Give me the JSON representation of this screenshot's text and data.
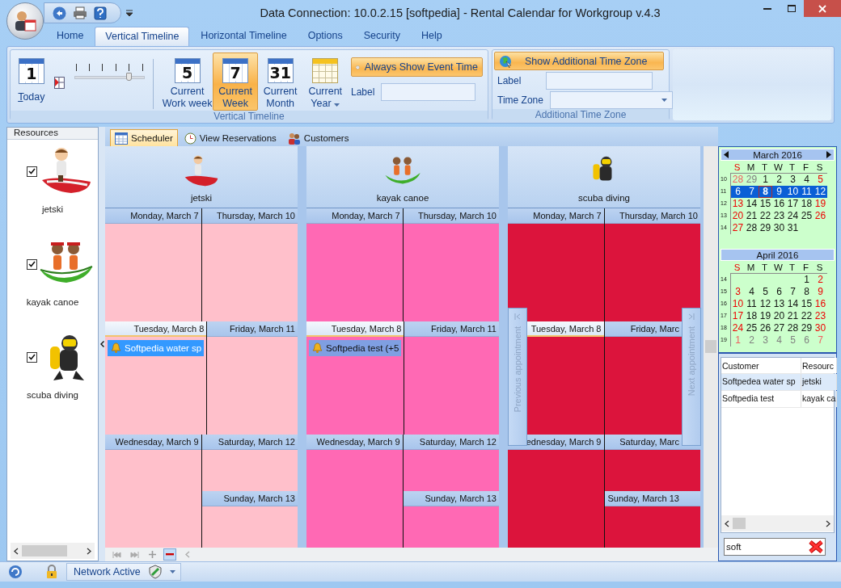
{
  "window": {
    "title": "Data Connection: 10.0.2.15 [softpedia] - Rental Calendar for Workgroup v.4.3"
  },
  "ribbon_tabs": [
    {
      "label": "Home",
      "selected": false
    },
    {
      "label": "Vertical Timeline",
      "selected": true
    },
    {
      "label": "Horizontal Timeline",
      "selected": false
    },
    {
      "label": "Options",
      "selected": false
    },
    {
      "label": "Security",
      "selected": false
    },
    {
      "label": "Help",
      "selected": false
    }
  ],
  "ribbon": {
    "today": {
      "digit": "1",
      "label": "Today"
    },
    "zoom_slider": {
      "level": 0.78
    },
    "view_buttons": [
      {
        "kind": "calendar",
        "digit": "5",
        "lines": [
          "Current",
          "Work week"
        ],
        "selected": false,
        "dropdown": false
      },
      {
        "kind": "calendar",
        "digit": "7",
        "lines": [
          "Current",
          "Week"
        ],
        "selected": true,
        "dropdown": false
      },
      {
        "kind": "calendar",
        "digit": "31",
        "lines": [
          "Current",
          "Month"
        ],
        "selected": false,
        "dropdown": false
      },
      {
        "kind": "year",
        "lines": [
          "Current",
          "Year"
        ],
        "selected": false,
        "dropdown": true
      }
    ],
    "event_time_button": {
      "label": "Always Show Event Time",
      "selected": true
    },
    "label_field": {
      "label": "Label"
    },
    "group_label": "Vertical Timeline",
    "time_zone": {
      "button": "Show Additional Time Zone",
      "label_field": "Label",
      "zone_field": "Time Zone",
      "group_label": "Additional Time Zone"
    }
  },
  "resources_panel": {
    "title": "Resources",
    "items": [
      {
        "name": "jetski",
        "checked": true
      },
      {
        "name": "kayak canoe",
        "checked": true
      },
      {
        "name": "scuba diving",
        "checked": true
      }
    ]
  },
  "scheduler_tabs": [
    {
      "label": "Scheduler",
      "selected": true
    },
    {
      "label": "View Reservations",
      "selected": false
    },
    {
      "label": "Customers",
      "selected": false
    }
  ],
  "scheduler": {
    "resources": [
      {
        "name": "jetski",
        "color": "#ffc0cb",
        "rows": [
          [
            [
              {
                "header": "Monday, March 7",
                "today": false
              }
            ],
            [
              {
                "header": "Thursday, March 10",
                "today": false
              }
            ]
          ],
          [
            [
              {
                "header": "Tuesday, March 8",
                "today": true,
                "appointment": {
                  "text": "Softpedia water sp",
                  "selected": true
                }
              }
            ],
            [
              {
                "header": "Friday, March 11",
                "today": false
              }
            ]
          ],
          [
            [
              {
                "header": "Wednesday, March 9",
                "today": false
              }
            ],
            [
              {
                "header": "Saturday, March 12",
                "today": false
              },
              {
                "header": "Sunday, March 13",
                "today": false
              }
            ]
          ]
        ]
      },
      {
        "name": "kayak canoe",
        "color": "#ff69b4",
        "rows": [
          [
            [
              {
                "header": "Monday, March 7",
                "today": false
              }
            ],
            [
              {
                "header": "Thursday, March 10",
                "today": false
              }
            ]
          ],
          [
            [
              {
                "header": "Tuesday, March 8",
                "today": true,
                "appointment": {
                  "text": "Softpedia test (+5",
                  "selected": false
                }
              }
            ],
            [
              {
                "header": "Friday, March 11",
                "today": false
              }
            ]
          ],
          [
            [
              {
                "header": "Wednesday, March 9",
                "today": false
              }
            ],
            [
              {
                "header": "Saturday, March 12",
                "today": false
              },
              {
                "header": "Sunday, March 13",
                "today": false
              }
            ]
          ]
        ]
      },
      {
        "name": "scuba diving",
        "color": "#dc143c",
        "rows": [
          [
            [
              {
                "header": "Monday, March 7",
                "today": false
              }
            ],
            [
              {
                "header": "Thursday, March 10",
                "today": false
              }
            ]
          ],
          [
            [
              {
                "header": "Tuesday, March 8",
                "today": true
              }
            ],
            [
              {
                "header": "Friday, Marc",
                "today": false
              }
            ]
          ],
          [
            [
              {
                "header": "ednesday, March 9",
                "today": false
              }
            ],
            [
              {
                "header": "Saturday, Marc",
                "today": false
              },
              {
                "header": "Sunday, March 13",
                "today": false
              }
            ]
          ]
        ]
      }
    ],
    "previous_button": "Previous appointment",
    "next_button": "Next appointment"
  },
  "calendar": {
    "months": [
      {
        "title": "March 2016",
        "weekdays": [
          "S",
          "M",
          "T",
          "W",
          "T",
          "F",
          "S"
        ],
        "weeks": [
          {
            "number": "10",
            "selected": false,
            "days": [
              {
                "d": "28",
                "kind": "other"
              },
              {
                "d": "29",
                "kind": "other"
              },
              {
                "d": "1",
                "kind": "day"
              },
              {
                "d": "2",
                "kind": "day"
              },
              {
                "d": "3",
                "kind": "day"
              },
              {
                "d": "4",
                "kind": "day"
              },
              {
                "d": "5",
                "kind": "day"
              }
            ]
          },
          {
            "number": "11",
            "selected": true,
            "days": [
              {
                "d": "6",
                "kind": "day"
              },
              {
                "d": "7",
                "kind": "day"
              },
              {
                "d": "8",
                "kind": "today"
              },
              {
                "d": "9",
                "kind": "day"
              },
              {
                "d": "10",
                "kind": "day"
              },
              {
                "d": "11",
                "kind": "day"
              },
              {
                "d": "12",
                "kind": "day"
              }
            ]
          },
          {
            "number": "12",
            "selected": false,
            "days": [
              {
                "d": "13",
                "kind": "day"
              },
              {
                "d": "14",
                "kind": "day"
              },
              {
                "d": "15",
                "kind": "day"
              },
              {
                "d": "16",
                "kind": "day"
              },
              {
                "d": "17",
                "kind": "day"
              },
              {
                "d": "18",
                "kind": "day"
              },
              {
                "d": "19",
                "kind": "day"
              }
            ]
          },
          {
            "number": "13",
            "selected": false,
            "days": [
              {
                "d": "20",
                "kind": "day"
              },
              {
                "d": "21",
                "kind": "day"
              },
              {
                "d": "22",
                "kind": "day"
              },
              {
                "d": "23",
                "kind": "day"
              },
              {
                "d": "24",
                "kind": "day"
              },
              {
                "d": "25",
                "kind": "day"
              },
              {
                "d": "26",
                "kind": "day"
              }
            ]
          },
          {
            "number": "14",
            "selected": false,
            "days": [
              {
                "d": "27",
                "kind": "day"
              },
              {
                "d": "28",
                "kind": "day"
              },
              {
                "d": "29",
                "kind": "day"
              },
              {
                "d": "30",
                "kind": "day"
              },
              {
                "d": "31",
                "kind": "day"
              },
              {
                "kind": "blank"
              },
              {
                "kind": "blank"
              }
            ]
          }
        ]
      },
      {
        "title": "April 2016",
        "weekdays": [
          "S",
          "M",
          "T",
          "W",
          "T",
          "F",
          "S"
        ],
        "weeks": [
          {
            "number": "14",
            "selected": false,
            "days": [
              {
                "kind": "blank"
              },
              {
                "kind": "blank"
              },
              {
                "kind": "blank"
              },
              {
                "kind": "blank"
              },
              {
                "kind": "blank"
              },
              {
                "d": "1",
                "kind": "day"
              },
              {
                "d": "2",
                "kind": "day"
              }
            ]
          },
          {
            "number": "15",
            "selected": false,
            "days": [
              {
                "d": "3",
                "kind": "day"
              },
              {
                "d": "4",
                "kind": "day"
              },
              {
                "d": "5",
                "kind": "day"
              },
              {
                "d": "6",
                "kind": "day"
              },
              {
                "d": "7",
                "kind": "day"
              },
              {
                "d": "8",
                "kind": "day"
              },
              {
                "d": "9",
                "kind": "day"
              }
            ]
          },
          {
            "number": "16",
            "selected": false,
            "days": [
              {
                "d": "10",
                "kind": "day"
              },
              {
                "d": "11",
                "kind": "day"
              },
              {
                "d": "12",
                "kind": "day"
              },
              {
                "d": "13",
                "kind": "day"
              },
              {
                "d": "14",
                "kind": "day"
              },
              {
                "d": "15",
                "kind": "day"
              },
              {
                "d": "16",
                "kind": "day"
              }
            ]
          },
          {
            "number": "17",
            "selected": false,
            "days": [
              {
                "d": "17",
                "kind": "day"
              },
              {
                "d": "18",
                "kind": "day"
              },
              {
                "d": "19",
                "kind": "day"
              },
              {
                "d": "20",
                "kind": "day"
              },
              {
                "d": "21",
                "kind": "day"
              },
              {
                "d": "22",
                "kind": "day"
              },
              {
                "d": "23",
                "kind": "day"
              }
            ]
          },
          {
            "number": "18",
            "selected": false,
            "days": [
              {
                "d": "24",
                "kind": "day"
              },
              {
                "d": "25",
                "kind": "day"
              },
              {
                "d": "26",
                "kind": "day"
              },
              {
                "d": "27",
                "kind": "day"
              },
              {
                "d": "28",
                "kind": "day"
              },
              {
                "d": "29",
                "kind": "day"
              },
              {
                "d": "30",
                "kind": "day"
              }
            ]
          },
          {
            "number": "19",
            "selected": false,
            "days": [
              {
                "d": "1",
                "kind": "other"
              },
              {
                "d": "2",
                "kind": "other"
              },
              {
                "d": "3",
                "kind": "other"
              },
              {
                "d": "4",
                "kind": "other"
              },
              {
                "d": "5",
                "kind": "other"
              },
              {
                "d": "6",
                "kind": "other"
              },
              {
                "d": "7",
                "kind": "other"
              }
            ]
          }
        ]
      }
    ]
  },
  "reservations": {
    "columns": [
      "Customer",
      "Resourc"
    ],
    "rows": [
      {
        "cells": [
          "Softpedea water sp",
          "jetski"
        ],
        "selected": true
      },
      {
        "cells": [
          "Softpedia test",
          "kayak ca"
        ],
        "selected": false
      }
    ]
  },
  "search": {
    "value": "soft"
  },
  "status_bar": {
    "network": "Network Active"
  }
}
